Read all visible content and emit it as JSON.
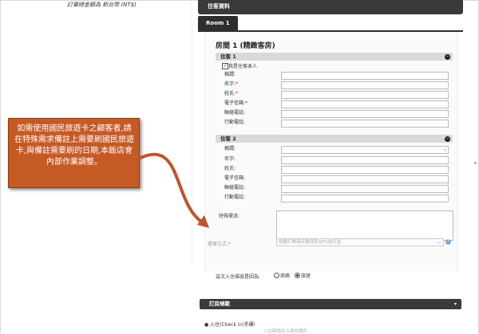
{
  "header": {
    "total_label": "訂單總金額為 新台幣 (NT$)"
  },
  "section": {
    "title": "住客資料"
  },
  "tabs": [
    {
      "label": "Room 1"
    }
  ],
  "room": {
    "title": "房間 1 (精緻客房)",
    "guest1": {
      "bar_label": "住客 1",
      "self_checkbox_label": "我是住客本人",
      "self_checked": true,
      "fields": [
        {
          "label": "稱謂:",
          "required": false
        },
        {
          "label": "名字:",
          "required": true
        },
        {
          "label": "姓氏:",
          "required": true
        },
        {
          "label": "電子信箱:",
          "required": true
        },
        {
          "label": "聯絡電話:",
          "required": false
        },
        {
          "label": "行動電話:",
          "required": false
        }
      ]
    },
    "guest2": {
      "bar_label": "住客 2",
      "fields": [
        {
          "label": "稱謂:"
        },
        {
          "label": "名字:"
        },
        {
          "label": "姓氏:"
        },
        {
          "label": "電子信箱:"
        },
        {
          "label": "聯絡電話:"
        },
        {
          "label": "行動電話:"
        }
      ]
    },
    "special_request_label": "特殊需求:",
    "payment_label": "擔保方式:*",
    "payment_value": "我要訂單保存擔保房30%為訂金",
    "first_stay_label": "這次入住福容是因為:",
    "first_stay_options": [
      {
        "label": "商務",
        "selected": false
      },
      {
        "label": "旅遊",
        "selected": true
      }
    ],
    "required_mark": "*"
  },
  "policy": {
    "title": "訂房規範",
    "checkin_title": "● 入住(Check in)手續!",
    "checkin_note": "入住時請出示身份證件"
  },
  "callout": {
    "text": "如需使用國民旅遊卡之顧客者,請在特殊需求備註上需要刷國民旅遊卡,與備註需要刷的日期,本飯店會內部作業調整。"
  },
  "icons": {
    "collapse": "minus-circle-icon",
    "help": "question-circle-icon"
  },
  "colors": {
    "callout_bg": "#c55a25",
    "bar_dark": "#3a3a3a",
    "arrow": "#c0552a"
  }
}
